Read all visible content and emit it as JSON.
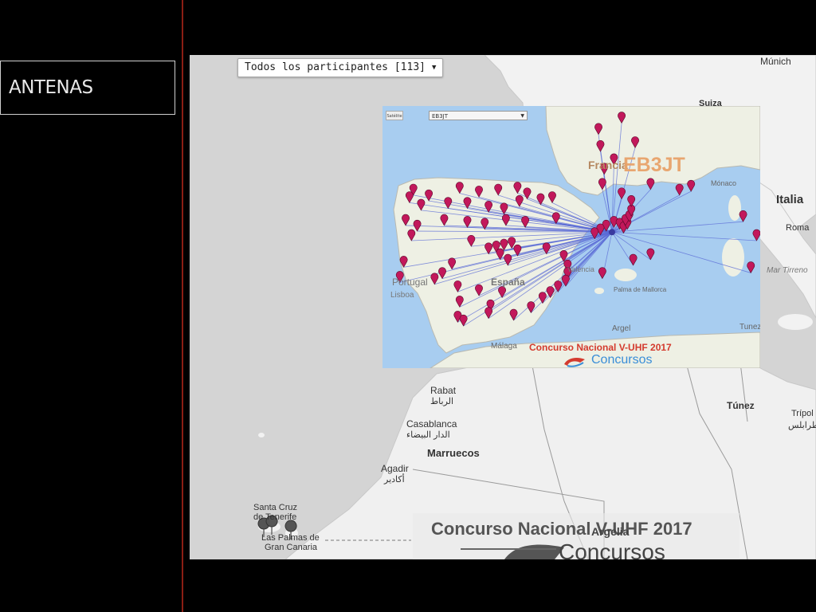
{
  "sidebar": {
    "title": "ANTENAS"
  },
  "map": {
    "participants_dropdown": {
      "selected": "Todos los participantes [113]"
    },
    "inset": {
      "station_dropdown": "EB3JT",
      "button_label": "Satélite",
      "callsign": "EB3JT",
      "contest_label": "Concurso Nacional V-UHF 2017",
      "brand": "Concursos"
    },
    "watermark": {
      "contest_label": "Concurso Nacional V-UHF 2017",
      "brand": "Concursos"
    },
    "place_labels": {
      "munich": "Múnich",
      "suiza": "Suiza",
      "francia": "Francia",
      "monaco": "Mónaco",
      "italia": "Italia",
      "roma": "Roma",
      "mar_tirreno": "Mar Tirreno",
      "portugal": "Portugal",
      "lisboa": "Lisboa",
      "espana": "España",
      "valencia": "València",
      "malaga": "Málaga",
      "palma": "Palma de Mallorca",
      "argel": "Argel",
      "tunez": "Tunez",
      "tunez2": "Túnez",
      "tripoli": "Trípol",
      "tripoli_ar": "طرابلس",
      "rabat": "Rabat",
      "rabat_ar": "الرباط",
      "casablanca": "Casablanca",
      "casablanca_ar": "الدار البيضاء",
      "marruecos": "Marruecos",
      "agadir": "Agadir",
      "agadir_ar": "أكادير",
      "santa_cruz": "Santa Cruz",
      "tenerife": "de Tenerife",
      "las_palmas": "Las Palmas de",
      "gran_canaria": "Gran Canaria",
      "argelia": "Argelia"
    },
    "colors": {
      "sea": "#d4d4d4",
      "land": "#f2f2f2",
      "inset_sea": "#a8cdf0",
      "inset_land": "#eef0e4",
      "marker": "#c2185b",
      "line": "#5b6bd6"
    },
    "hub": {
      "lat": 41.35,
      "lon": 1.9
    },
    "stations": [
      [
        43.3,
        -8.4
      ],
      [
        43.0,
        -7.6
      ],
      [
        43.4,
        -6.0
      ],
      [
        43.2,
        -5.0
      ],
      [
        43.3,
        -4.0
      ],
      [
        43.4,
        -3.0
      ],
      [
        43.1,
        -2.5
      ],
      [
        42.8,
        -1.8
      ],
      [
        42.9,
        -8.6
      ],
      [
        42.5,
        -8.0
      ],
      [
        42.6,
        -6.6
      ],
      [
        42.6,
        -5.6
      ],
      [
        42.4,
        -4.5
      ],
      [
        42.3,
        -3.7
      ],
      [
        42.7,
        -2.9
      ],
      [
        42.9,
        -1.2
      ],
      [
        41.7,
        -8.8
      ],
      [
        41.4,
        -8.2
      ],
      [
        41.7,
        -6.8
      ],
      [
        41.6,
        -5.6
      ],
      [
        41.5,
        -4.7
      ],
      [
        41.7,
        -3.6
      ],
      [
        41.6,
        -2.6
      ],
      [
        41.8,
        -1.0
      ],
      [
        40.9,
        -8.5
      ],
      [
        40.6,
        -5.4
      ],
      [
        40.4,
        -3.7
      ],
      [
        40.5,
        -3.3
      ],
      [
        40.3,
        -4.1
      ],
      [
        40.1,
        -3.0
      ],
      [
        40.2,
        -4.5
      ],
      [
        39.9,
        -3.9
      ],
      [
        39.6,
        -3.5
      ],
      [
        40.2,
        -1.5
      ],
      [
        39.8,
        -0.6
      ],
      [
        39.3,
        -0.4
      ],
      [
        38.9,
        -0.4
      ],
      [
        38.5,
        -0.5
      ],
      [
        38.2,
        -0.9
      ],
      [
        37.9,
        -1.3
      ],
      [
        37.6,
        -1.7
      ],
      [
        39.4,
        -6.4
      ],
      [
        38.9,
        -6.9
      ],
      [
        38.6,
        -7.3
      ],
      [
        38.2,
        -6.1
      ],
      [
        38.0,
        -5.0
      ],
      [
        37.9,
        -3.8
      ],
      [
        37.4,
        -6.0
      ],
      [
        37.2,
        -4.4
      ],
      [
        36.8,
        -4.5
      ],
      [
        36.6,
        -6.1
      ],
      [
        36.4,
        -5.8
      ],
      [
        36.7,
        -3.2
      ],
      [
        37.1,
        -2.3
      ],
      [
        39.5,
        -8.9
      ],
      [
        38.7,
        -9.1
      ],
      [
        41.6,
        2.0
      ],
      [
        41.5,
        2.3
      ],
      [
        41.4,
        1.6
      ],
      [
        41.3,
        2.5
      ],
      [
        41.2,
        1.3
      ],
      [
        41.0,
        1.0
      ],
      [
        41.5,
        2.7
      ],
      [
        41.7,
        2.6
      ],
      [
        41.9,
        2.8
      ],
      [
        42.2,
        2.9
      ],
      [
        42.7,
        2.9
      ],
      [
        43.1,
        2.4
      ],
      [
        43.6,
        1.4
      ],
      [
        44.4,
        1.5
      ],
      [
        44.9,
        2.0
      ],
      [
        45.6,
        1.3
      ],
      [
        46.5,
        1.2
      ],
      [
        47.1,
        2.4
      ],
      [
        45.8,
        3.1
      ],
      [
        43.6,
        3.9
      ],
      [
        43.3,
        5.4
      ],
      [
        43.5,
        6.0
      ],
      [
        41.9,
        8.7
      ],
      [
        40.9,
        9.4
      ],
      [
        39.2,
        9.1
      ],
      [
        39.6,
        3.0
      ],
      [
        39.9,
        3.9
      ],
      [
        38.9,
        1.4
      ]
    ]
  }
}
